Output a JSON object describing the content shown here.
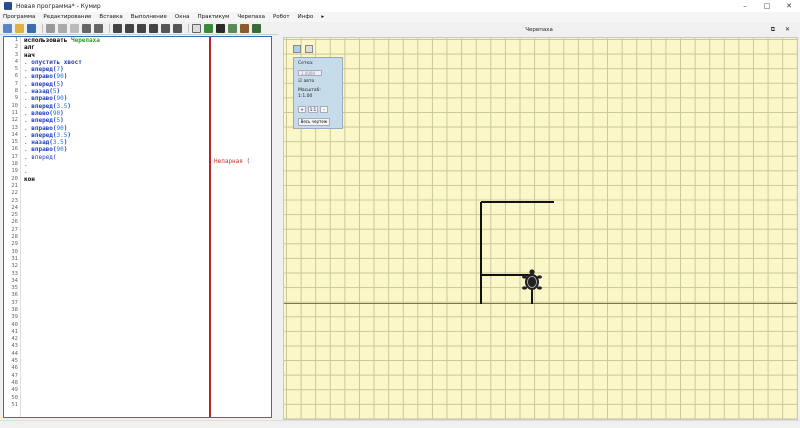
{
  "window": {
    "title": "Новая программа* - Кумир",
    "controls": [
      "–",
      "□",
      "✕"
    ]
  },
  "menu": [
    "Программа",
    "Редактирование",
    "Вставка",
    "Выполнение",
    "Окна",
    "Практикум",
    "Черепаха",
    "Робот",
    "Инфо",
    "▸"
  ],
  "editor": {
    "line_count": 51,
    "code_lines": [
      [
        {
          "t": "использовать ",
          "c": "kw"
        },
        {
          "t": "Черепаха",
          "c": "mod"
        }
      ],
      [
        {
          "t": "алг",
          "c": "kw"
        }
      ],
      [
        {
          "t": "нач",
          "c": "kw"
        }
      ],
      [
        {
          "t": ". ",
          "c": "dot"
        },
        {
          "t": "опустить хвост",
          "c": "cmd"
        }
      ],
      [
        {
          "t": ". ",
          "c": "dot"
        },
        {
          "t": "вперед(",
          "c": "cmd"
        },
        {
          "t": "7",
          "c": "num"
        },
        {
          "t": ")",
          "c": "cmd"
        }
      ],
      [
        {
          "t": ". ",
          "c": "dot"
        },
        {
          "t": "вправо(",
          "c": "cmd"
        },
        {
          "t": "90",
          "c": "num"
        },
        {
          "t": ")",
          "c": "cmd"
        }
      ],
      [
        {
          "t": ". ",
          "c": "dot"
        },
        {
          "t": "вперед(",
          "c": "cmd"
        },
        {
          "t": "5",
          "c": "num"
        },
        {
          "t": ")",
          "c": "cmd"
        }
      ],
      [
        {
          "t": ". ",
          "c": "dot"
        },
        {
          "t": "назад(",
          "c": "cmd"
        },
        {
          "t": "5",
          "c": "num"
        },
        {
          "t": ")",
          "c": "cmd"
        }
      ],
      [
        {
          "t": ". ",
          "c": "dot"
        },
        {
          "t": "вправо(",
          "c": "cmd"
        },
        {
          "t": "90",
          "c": "num"
        },
        {
          "t": ")",
          "c": "cmd"
        }
      ],
      [
        {
          "t": ". ",
          "c": "dot"
        },
        {
          "t": "вперед(",
          "c": "cmd"
        },
        {
          "t": "3.5",
          "c": "num"
        },
        {
          "t": ")",
          "c": "cmd"
        }
      ],
      [
        {
          "t": ". ",
          "c": "dot"
        },
        {
          "t": "влево(",
          "c": "cmd"
        },
        {
          "t": "90",
          "c": "num"
        },
        {
          "t": ")",
          "c": "cmd"
        }
      ],
      [
        {
          "t": ". ",
          "c": "dot"
        },
        {
          "t": "вперед(",
          "c": "cmd"
        },
        {
          "t": "5",
          "c": "num"
        },
        {
          "t": ")",
          "c": "cmd"
        }
      ],
      [
        {
          "t": ". ",
          "c": "dot"
        },
        {
          "t": "вправо(",
          "c": "cmd"
        },
        {
          "t": "90",
          "c": "num"
        },
        {
          "t": ")",
          "c": "cmd"
        }
      ],
      [
        {
          "t": ". ",
          "c": "dot"
        },
        {
          "t": "вперед(",
          "c": "cmd"
        },
        {
          "t": "3.5",
          "c": "num"
        },
        {
          "t": ")",
          "c": "cmd"
        }
      ],
      [
        {
          "t": ". ",
          "c": "dot"
        },
        {
          "t": "назад(",
          "c": "cmd"
        },
        {
          "t": "3.5",
          "c": "num"
        },
        {
          "t": ")",
          "c": "cmd"
        }
      ],
      [
        {
          "t": ". ",
          "c": "dot"
        },
        {
          "t": "вправо(",
          "c": "cmd"
        },
        {
          "t": "90",
          "c": "num"
        },
        {
          "t": ")",
          "c": "cmd"
        }
      ],
      [
        {
          "t": ". ",
          "c": "dot"
        },
        {
          "t": "вперед(",
          "c": "dot"
        }
      ],
      [
        {
          "t": ".",
          "c": "dot"
        }
      ],
      [
        {
          "t": ".",
          "c": "dot"
        }
      ],
      [
        {
          "t": "кон",
          "c": "kw"
        }
      ]
    ],
    "error_message": "Непарная ("
  },
  "turtle_window": {
    "title": "Черепаха",
    "header_icons": [
      "⧉",
      "✕"
    ],
    "panel": {
      "step_label": "Сетка:",
      "step_value": "1.0000",
      "auto_label": "авто",
      "scale_label": "Масштаб:",
      "scale_value": "1:1.00",
      "zoom_in": "+",
      "zoom_reset": "1:1",
      "zoom_out": "-",
      "whole_drawing_button": "Весь чертеж"
    }
  },
  "drawing_segments": [
    [
      0,
      0,
      0,
      7
    ],
    [
      0,
      7,
      5,
      7
    ],
    [
      0,
      2,
      3.5,
      2
    ],
    [
      3.5,
      2,
      3.5,
      0
    ]
  ],
  "turtle_position": [
    3.5,
    1.5
  ],
  "colors": {
    "accent": "#2f6fbf",
    "error": "#c03030",
    "canvas_bg": "#fbf7c9",
    "panel_bg": "#c7dcea"
  }
}
